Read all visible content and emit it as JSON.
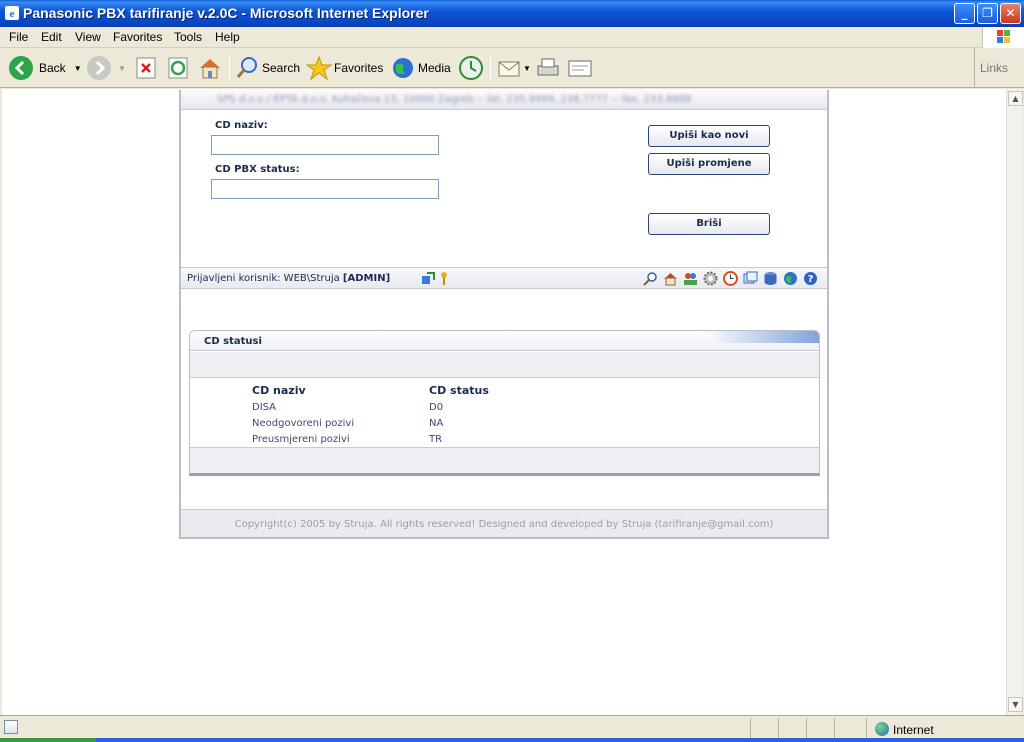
{
  "window": {
    "title": "Panasonic PBX tarifiranje v.2.0C - Microsoft Internet Explorer",
    "controls": {
      "minimize": "_",
      "maximize": "❐",
      "close": "✕"
    }
  },
  "menu": [
    "File",
    "Edit",
    "View",
    "Favorites",
    "Tools",
    "Help"
  ],
  "toolbar": {
    "back": "Back",
    "search": "Search",
    "favorites": "Favorites",
    "media": "Media",
    "links": "Links"
  },
  "page": {
    "header_text": "SPS d.o.o / EPTA d.o.o. Kuhačeva 13, 10000 Zagreb -- tel. 235.9999, 238.7777 -- fax. 233.8888",
    "form": {
      "naziv_label": "CD naziv:",
      "naziv_value": "",
      "status_label": "CD PBX status:",
      "status_value": "",
      "btn_new": "Upiši kao novi",
      "btn_update": "Upiši promjene",
      "btn_delete": "Briši"
    },
    "userbar": {
      "prefix": "Prijavljeni korisnik: WEB\\Struja ",
      "role": "[ADMIN]"
    },
    "panel": {
      "title": "CD statusi",
      "columns": [
        "CD naziv",
        "CD status"
      ],
      "rows": [
        {
          "naziv": "DISA",
          "status": "D0"
        },
        {
          "naziv": "Neodgovoreni pozivi",
          "status": "NA"
        },
        {
          "naziv": "Preusmjereni pozivi",
          "status": "TR"
        }
      ]
    },
    "footer": "Copyright(c) 2005 by Struja. All rights reserved! Designed and developed by Struja (tarifiranje@gmail.com)"
  },
  "statusbar": {
    "zone": "Internet"
  },
  "colors": {
    "accent": "#1b2a4e",
    "title_bar": "#0a52d0"
  }
}
